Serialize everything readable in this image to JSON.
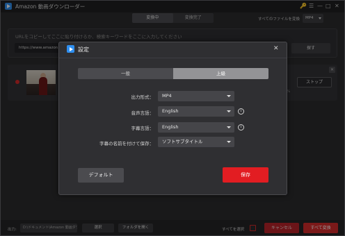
{
  "app": {
    "title": "Amazon 動画ダウンローダー",
    "window_controls": [
      "🔑",
      "☰",
      "—",
      "□",
      "✕"
    ]
  },
  "top_tabs": [
    {
      "label": "変換中",
      "active": true
    },
    {
      "label": "変換完了",
      "active": false
    }
  ],
  "convert_all_to": {
    "label": "すべてのファイルを変換",
    "format": "MP4"
  },
  "url_panel": {
    "hint": "URLをコピーしてここに貼り付けるか、検索キーワードをここに入力してください",
    "input_value": "https://www.amazon.c",
    "search_label": "探す"
  },
  "list_item": {
    "stop_label": "ストップ",
    "percent_suffix": "%"
  },
  "bottom_bar": {
    "output_label": "出力:",
    "output_path": "D:\\ドキュメント\\Amazon 動画ダウンロード",
    "select_label": "選択",
    "open_folder_label": "フォルダを開く",
    "select_all_label": "すべてを選択",
    "cancel_label": "キャンセル",
    "convert_all_label": "すべて変換"
  },
  "settings_dialog": {
    "title": "設定",
    "close_glyph": "✕",
    "tabs": [
      {
        "label": "一般",
        "active": false
      },
      {
        "label": "上級",
        "active": true
      }
    ],
    "fields": {
      "output_format": {
        "label": "出力形式：",
        "value": "MP4"
      },
      "audio_language": {
        "label": "音声言語：",
        "value": "English"
      },
      "subtitle_language": {
        "label": "字幕言語：",
        "value": "English"
      },
      "subtitle_save_as": {
        "label": "字幕の名前を付けて保存：",
        "value": "ソフトサブタイトル"
      }
    },
    "info_glyph": "i",
    "default_label": "デフォルト",
    "save_label": "保存"
  },
  "colors": {
    "accent_red": "#e21d22",
    "brand_blue": "#2f8ff0"
  }
}
